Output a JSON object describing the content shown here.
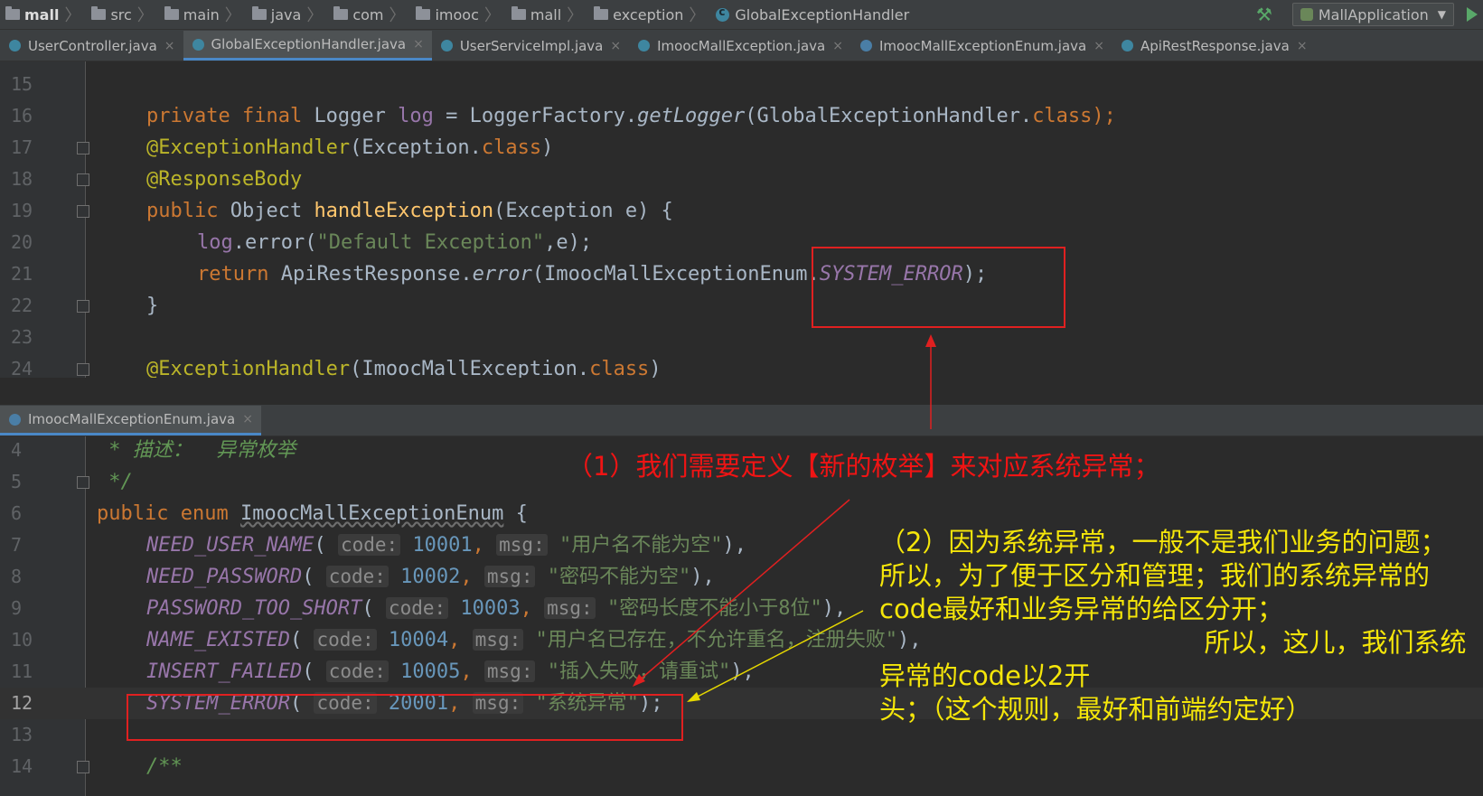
{
  "breadcrumb": {
    "project": "mall",
    "items": [
      "src",
      "main",
      "java",
      "com",
      "imooc",
      "mall",
      "exception"
    ],
    "current": "GlobalExceptionHandler"
  },
  "toolbar": {
    "run_config": "MallApplication"
  },
  "top_tabs": [
    {
      "label": "UserController.java",
      "active": false
    },
    {
      "label": "GlobalExceptionHandler.java",
      "active": true
    },
    {
      "label": "UserServiceImpl.java",
      "active": false
    },
    {
      "label": "ImoocMallException.java",
      "active": false
    },
    {
      "label": "ImoocMallExceptionEnum.java",
      "active": false
    },
    {
      "label": "ApiRestResponse.java",
      "active": false
    }
  ],
  "top_editor": {
    "line_numbers": [
      "15",
      "16",
      "17",
      "18",
      "19",
      "20",
      "21",
      "22",
      "23",
      "24"
    ],
    "l16": {
      "a": "private final ",
      "b": "Logger ",
      "c": "log",
      "d": " = LoggerFactory.",
      "e": "getLogger",
      "f": "(GlobalExceptionHandler.",
      "g": "class",
      "h": ");"
    },
    "l17": {
      "a": "@ExceptionHandler",
      "b": "(Exception.",
      "c": "class",
      "d": ")"
    },
    "l18": {
      "a": "@ResponseBody"
    },
    "l19": {
      "a": "public ",
      "b": "Object ",
      "c": "handleException",
      "d": "(Exception e) {"
    },
    "l20": {
      "a": "log",
      "b": ".error(",
      "c": "\"Default Exception\"",
      "d": ",e);"
    },
    "l21": {
      "a": "return ",
      "b": "ApiRestResponse.",
      "c": "error",
      "d": "(ImoocMallExceptionEnum.",
      "e": "SYSTEM_ERROR",
      "f": ");"
    },
    "l22": {
      "a": "}"
    },
    "l24": {
      "a": "@ExceptionHandler",
      "b": "(ImoocMallException.",
      "c": "class",
      "d": ")"
    }
  },
  "bottom_tab": {
    "label": "ImoocMallExceptionEnum.java"
  },
  "bottom_editor": {
    "line_numbers": [
      "4",
      "5",
      "6",
      "7",
      "8",
      "9",
      "10",
      "11",
      "12",
      "13",
      "14"
    ],
    "l4": " * 描述：  异常枚举",
    "l5": " */",
    "l6": {
      "a": "public enum ",
      "b": "ImoocMallExceptionEnum",
      "c": " {"
    },
    "hint_code": "code:",
    "hint_msg": "msg:",
    "entries": [
      {
        "name": "NEED_USER_NAME",
        "code": "10001",
        "msg": "\"用户名不能为空\"",
        "end": "),"
      },
      {
        "name": "NEED_PASSWORD",
        "code": "10002",
        "msg": "\"密码不能为空\"",
        "end": "),"
      },
      {
        "name": "PASSWORD_TOO_SHORT",
        "code": "10003",
        "msg": "\"密码长度不能小于8位\"",
        "end": "),"
      },
      {
        "name": "NAME_EXISTED",
        "code": "10004",
        "msg": "\"用户名已存在，不允许重名，注册失败\"",
        "end": "),"
      },
      {
        "name": "INSERT_FAILED",
        "code": "10005",
        "msg": "\"插入失败，请重试\"",
        "end": "),"
      },
      {
        "name": "SYSTEM_ERROR",
        "code": "20001",
        "msg": "\"系统异常\"",
        "end": ");"
      }
    ],
    "l14": "/**"
  },
  "annotations": {
    "note1": "（1）我们需要定义【新的枚举】来对应系统异常；",
    "note2": "（2）因为系统异常，一般不是我们业务的问题；\n所以，为了便于区分和管理；我们的系统异常的\ncode最好和业务异常的给区分开；\n                                       所以，这儿，我们系统异常的code以2开\n头；（这个规则，最好和前端约定好）",
    "red_color": "#F01414",
    "yellow_color": "#F5E60A"
  }
}
